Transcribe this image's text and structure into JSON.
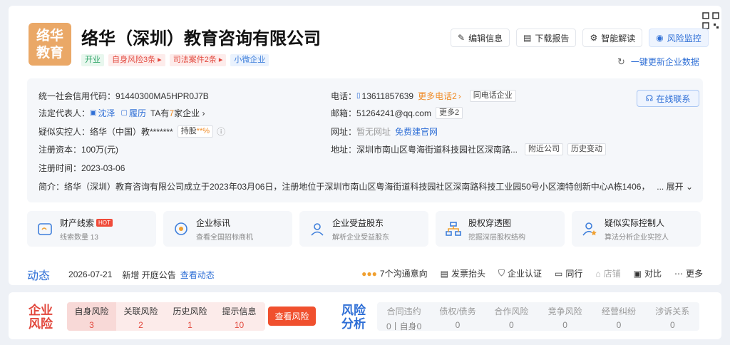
{
  "company": {
    "logo_text_line1": "络华",
    "logo_text_line2": "教育",
    "name": "络华（深圳）教育咨询有限公司",
    "tags": [
      {
        "label": "开业",
        "color": "green"
      },
      {
        "label": "自身风险3条",
        "color": "red"
      },
      {
        "label": "司法案件2条",
        "color": "red"
      },
      {
        "label": "小微企业",
        "color": "blue"
      }
    ]
  },
  "actions": {
    "edit": "编辑信息",
    "download": "下载报告",
    "ai": "智能解读",
    "monitor": "风险监控",
    "update": "一键更新企业数据"
  },
  "info": {
    "credit_code_label": "统一社会信用代码：",
    "credit_code": "91440300MA5HPR0J7B",
    "legal_rep_label": "法定代表人：",
    "legal_rep": "沈泽",
    "resume": "履历",
    "ta_prefix": "TA有",
    "ta_count": "7",
    "ta_suffix": "家企业",
    "controller_label": "疑似实控人：",
    "controller": "络华（中国）教*******",
    "holding_label": "持股",
    "holding_value": "**%",
    "capital_label": "注册资本：",
    "capital": "100万(元)",
    "reg_time_label": "注册时间：",
    "reg_time": "2023-03-06",
    "phone_label": "电话：",
    "phone": "13611857639",
    "more_phone": "更多电话2",
    "same_phone": "同电话企业",
    "email_label": "邮箱：",
    "email": "51264241@qq.com",
    "more_email": "更多2",
    "website_label": "网址：",
    "website": "暂无网址",
    "build_site": "免费建官网",
    "address_label": "地址：",
    "address": "深圳市南山区粤海街道科技园社区深南路...",
    "nearby": "附近公司",
    "history": "历史变动",
    "online_contact": "在线联系",
    "intro_label": "简介：",
    "intro": "络华（深圳）教育咨询有限公司成立于2023年03月06日，注册地位于深圳市南山区粤海街道科技园社区深南路科技工业园50号小区澳特创新中心A栋1406，",
    "expand": "... 展开"
  },
  "features": [
    {
      "title": "财产线索",
      "sub": "线索数量 13",
      "hot": "HOT"
    },
    {
      "title": "企业标讯",
      "sub": "查看全国招标商机"
    },
    {
      "title": "企业受益股东",
      "sub": "解析企业受益股东"
    },
    {
      "title": "股权穿透图",
      "sub": "挖掘深层股权结构"
    },
    {
      "title": "疑似实际控制人",
      "sub": "算法分析企业实控人"
    }
  ],
  "dynamic": {
    "title": "动态",
    "date": "2026-07-21",
    "text": "新增 开庭公告",
    "link": "查看动态",
    "tools": [
      "7个沟通意向",
      "发票抬头",
      "企业认证",
      "同行",
      "店铺",
      "对比",
      "更多"
    ]
  },
  "risk": {
    "label_line1": "企业",
    "label_line2": "风险",
    "cells": [
      {
        "h": "自身风险",
        "v": "3"
      },
      {
        "h": "关联风险",
        "v": "2"
      },
      {
        "h": "历史风险",
        "v": "1"
      },
      {
        "h": "提示信息",
        "v": "10"
      }
    ],
    "button": "查看风险"
  },
  "analysis": {
    "label_line1": "风险",
    "label_line2": "分析",
    "cells": [
      {
        "h": "合同违约",
        "v": "0丨自身0"
      },
      {
        "h": "债权/债务",
        "v": "0"
      },
      {
        "h": "合作风险",
        "v": "0"
      },
      {
        "h": "竞争风险",
        "v": "0"
      },
      {
        "h": "经营纠纷",
        "v": "0"
      },
      {
        "h": "涉诉关系",
        "v": "0"
      }
    ]
  },
  "colors": {
    "brand_blue": "#2f6fd6",
    "risk_red": "#e2483d",
    "logo_bg": "#eaa867"
  }
}
